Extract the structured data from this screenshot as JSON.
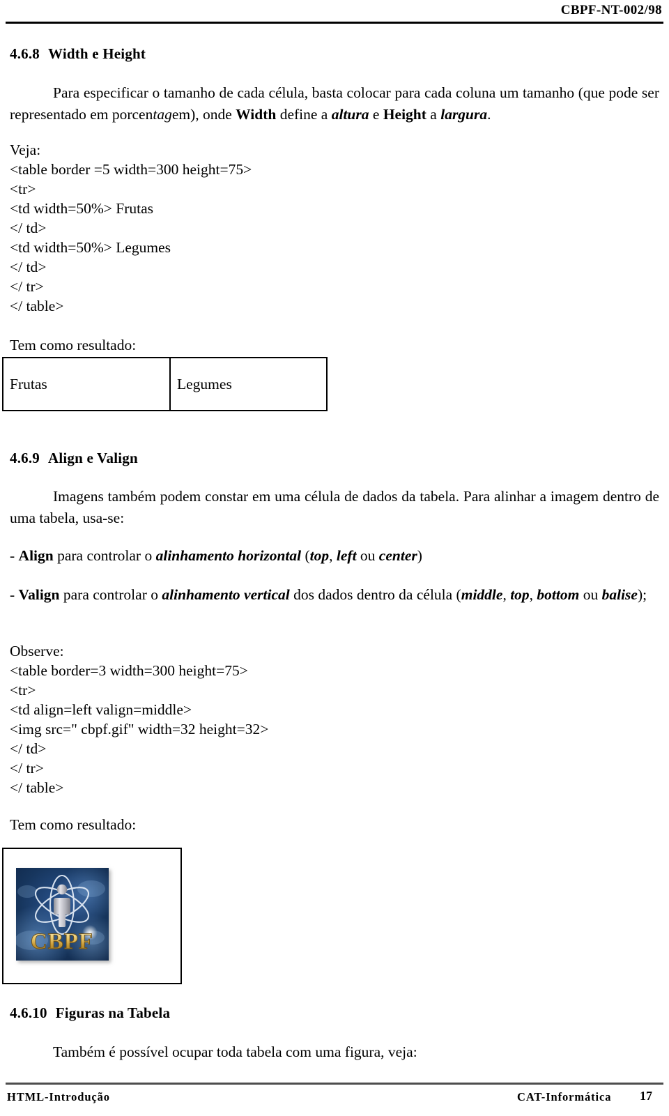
{
  "header": {
    "doc_code": "CBPF-NT-002/98"
  },
  "sections": {
    "width_height": {
      "number": "4.6.8",
      "title": "Width e Height",
      "paragraph": {
        "line1_a": "Para especificar o tamanho de cada célula, basta colocar para cada coluna um tamanho (que pode ser representado em porcen",
        "tag_italic": "tag",
        "line1_b": "em), onde ",
        "bold_width": "Width",
        "line1_c": " define a ",
        "italic_altura": "altura",
        "line1_d": " e ",
        "bold_height": "Height",
        "line1_e": " a ",
        "italic_largura": "largura",
        "line1_f": "."
      },
      "veja_label": "Veja:",
      "code_lines": [
        "<table border =5 width=300 height=75>",
        "<tr>",
        "<td width=50%> Frutas",
        "</ td>",
        "<td width=50%> Legumes",
        "</ td>",
        "</ tr>",
        "</ table>"
      ],
      "result_label": "Tem como resultado:",
      "result_table": {
        "cells": [
          "Frutas",
          "Legumes"
        ]
      }
    },
    "align_valign": {
      "number": "4.6.9",
      "title": "Align e Valign",
      "paragraph_a": "Imagens também podem constar em uma célula de dados da tabela. Para alinhar a imagem dentro de uma tabela, usa-se:",
      "bullet_align": {
        "dash": "- ",
        "keyword": "Align",
        "mid": " para controlar o ",
        "italic_phrase": "alinhamento horizontal",
        "paren_open": " (",
        "opt1": "top",
        "sep1": ", ",
        "opt2": "left",
        "ou": " ou ",
        "opt3": "center",
        "paren_close": ")"
      },
      "bullet_valign": {
        "dash": "- ",
        "keyword": "Valign",
        "mid": " para controlar o  ",
        "italic_phrase": "alinhamento vertical",
        "mid2": " dos dados dentro da célula (",
        "opt1": "middle",
        "sep1": ", ",
        "opt2": "top",
        "sep2": ", ",
        "opt3": "bottom",
        "ou": " ou ",
        "opt4": "balise",
        "close": ");"
      },
      "observe_label": "Observe:",
      "code_lines": [
        "<table border=3 width=300 height=75>",
        "<tr>",
        "<td align=left valign=middle>",
        "<img src=\" cbpf.gif\" width=32 height=32>",
        "</ td>",
        "</ tr>",
        "</ table>"
      ],
      "result_label": "Tem como resultado:",
      "figure": {
        "alt": "CBPF logo",
        "wordmark": "CBPF",
        "colors": {
          "background_dark": "#17365e",
          "background_mid": "#2a5490",
          "orbit": "#dfe9f5",
          "gold_light": "#f6e2a0",
          "gold_mid": "#d9ae4a",
          "gold_dark": "#9a7320",
          "figure": "#c9c9cf"
        }
      }
    },
    "figuras_na_tabela": {
      "number": "4.6.10",
      "title": "Figuras na Tabela",
      "paragraph": "Também é possível ocupar toda tabela com uma figura, veja:"
    }
  },
  "footer": {
    "left": "HTML-Introdução",
    "right": "CAT-Informática",
    "page_number": "17"
  }
}
